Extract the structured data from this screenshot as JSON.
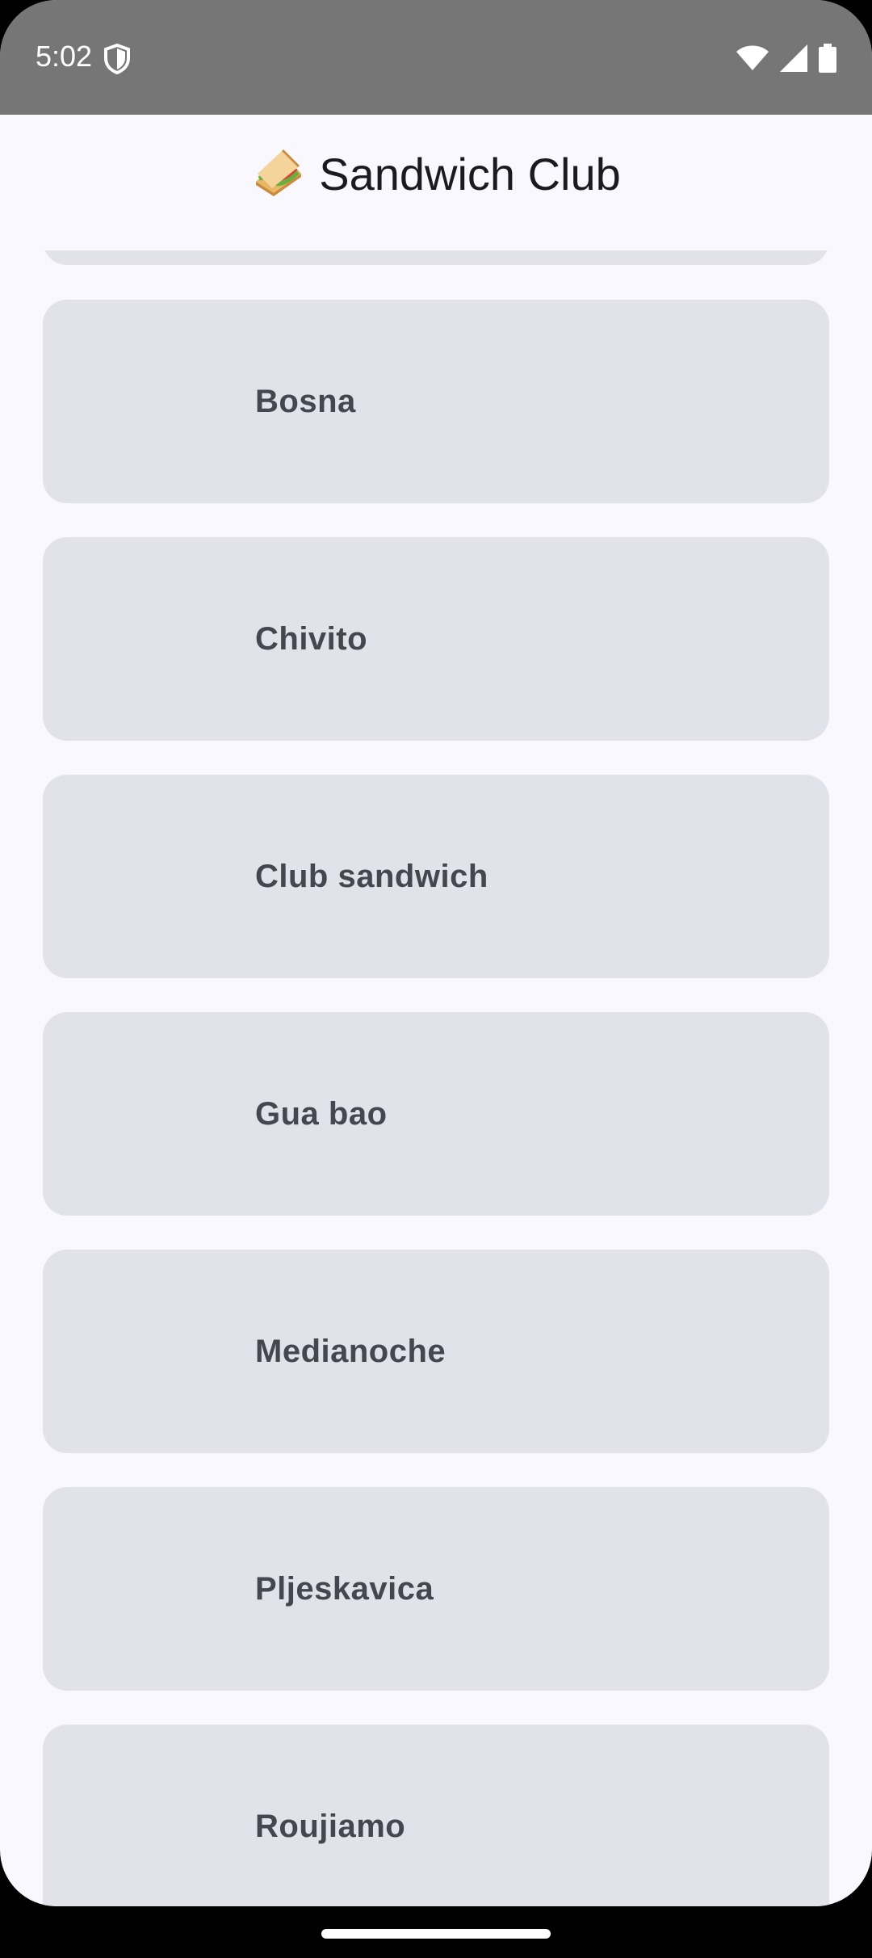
{
  "status_bar": {
    "time": "5:02",
    "icons": [
      "shield-icon",
      "wifi-icon",
      "signal-icon",
      "battery-icon"
    ]
  },
  "app_bar": {
    "title": "Sandwich Club",
    "icon": "sandwich-icon"
  },
  "sandwiches": [
    {
      "label": ""
    },
    {
      "label": "Bosna"
    },
    {
      "label": "Chivito"
    },
    {
      "label": "Club sandwich"
    },
    {
      "label": "Gua bao"
    },
    {
      "label": "Medianoche"
    },
    {
      "label": "Pljeskavica"
    },
    {
      "label": "Roujiamo"
    }
  ],
  "colors": {
    "status_bar": "#767676",
    "background": "#F9F8FE",
    "card": "#E2E2EA",
    "card_text": "#45464F",
    "title_text": "#1B1B1F"
  }
}
